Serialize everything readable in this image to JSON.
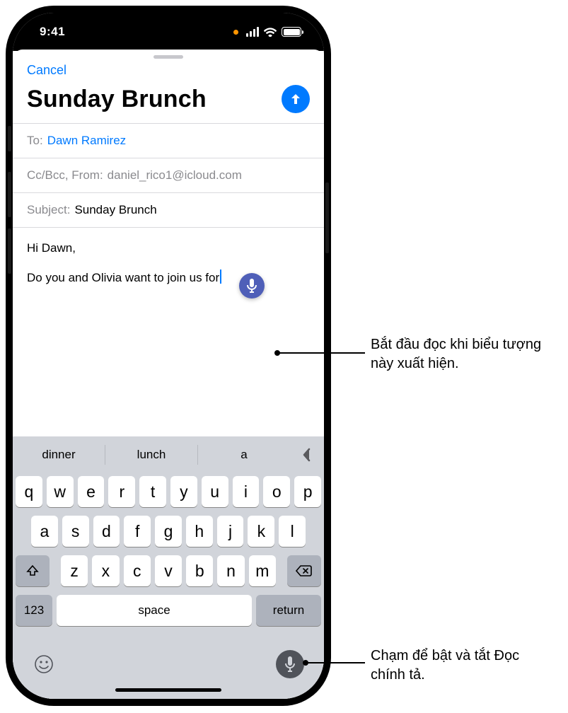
{
  "status": {
    "time": "9:41"
  },
  "compose": {
    "cancel": "Cancel",
    "title": "Sunday Brunch",
    "to_label": "To:",
    "to_value": "Dawn Ramirez",
    "ccbcc_label": "Cc/Bcc, From:",
    "from_value": "daniel_rico1@icloud.com",
    "subject_label": "Subject:",
    "subject_value": "Sunday Brunch",
    "body_line1": "Hi Dawn,",
    "body_line2": "Do you and Olivia want to join us for"
  },
  "keyboard": {
    "suggestions": [
      "dinner",
      "lunch",
      "a"
    ],
    "row1": [
      "q",
      "w",
      "e",
      "r",
      "t",
      "y",
      "u",
      "i",
      "o",
      "p"
    ],
    "row2": [
      "a",
      "s",
      "d",
      "f",
      "g",
      "h",
      "j",
      "k",
      "l"
    ],
    "row3": [
      "z",
      "x",
      "c",
      "v",
      "b",
      "n",
      "m"
    ],
    "numkey": "123",
    "space": "space",
    "return": "return"
  },
  "callouts": {
    "c1": "Bắt đầu đọc khi biểu tượng này xuất hiện.",
    "c2": "Chạm để bật và tắt Đọc chính tả."
  }
}
